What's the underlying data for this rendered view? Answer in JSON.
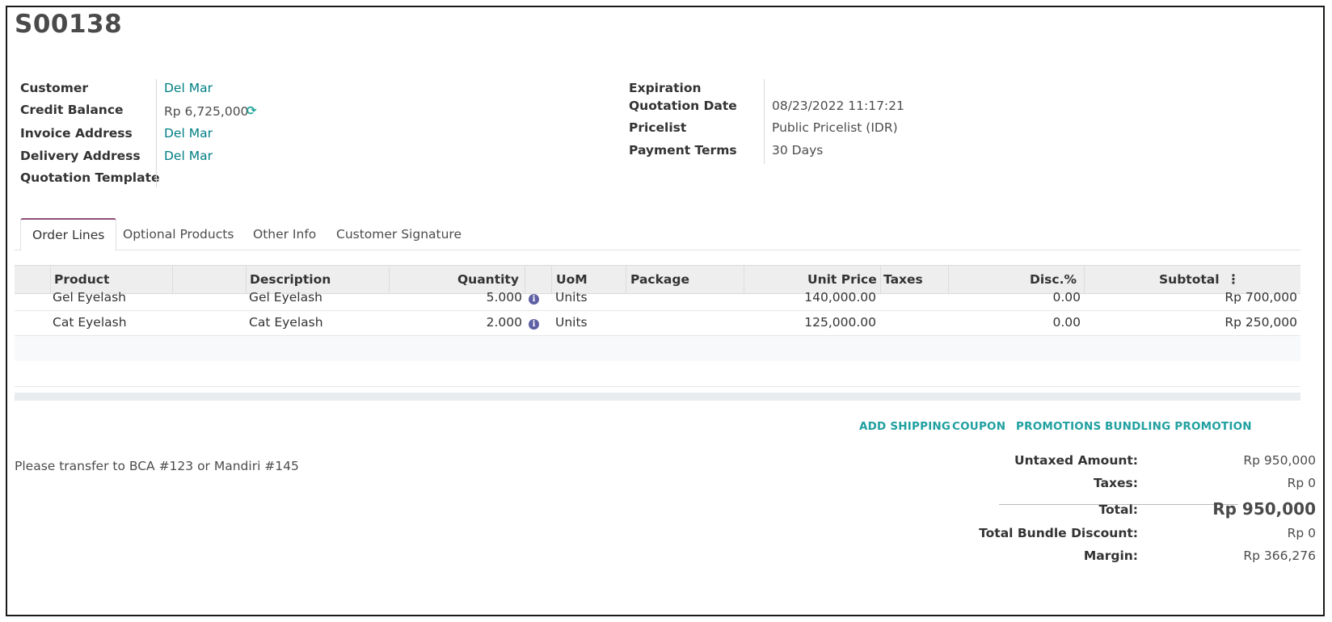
{
  "record": {
    "title": "S00138"
  },
  "left_fields": [
    {
      "label": "Customer",
      "value": "Del Mar",
      "link": true
    },
    {
      "label": "Credit Balance",
      "value": "Rp 6,725,000",
      "link": false,
      "icon": "refresh-icon"
    },
    {
      "label": "Invoice Address",
      "value": "Del Mar",
      "link": true
    },
    {
      "label": "Delivery Address",
      "value": "Del Mar",
      "link": true
    },
    {
      "label": "Quotation Template",
      "value": "",
      "link": false
    }
  ],
  "right_fields": [
    {
      "label": "Expiration",
      "value": ""
    },
    {
      "label": "Quotation Date",
      "value": "08/23/2022 11:17:21"
    },
    {
      "label": "Pricelist",
      "value": "Public Pricelist (IDR)"
    },
    {
      "label": "Payment Terms",
      "value": "30 Days"
    }
  ],
  "tabs": [
    {
      "label": "Order Lines",
      "active": true
    },
    {
      "label": "Optional Products",
      "active": false
    },
    {
      "label": "Other Info",
      "active": false
    },
    {
      "label": "Customer Signature",
      "active": false
    }
  ],
  "table": {
    "columns": [
      "Product",
      "Description",
      "Quantity",
      "UoM",
      "Package",
      "Unit Price",
      "Taxes",
      "Disc.%",
      "Subtotal"
    ],
    "rows": [
      {
        "product": "Gel Eyelash",
        "description": "Gel Eyelash",
        "quantity": "5.000",
        "uom": "Units",
        "package": "",
        "unit_price": "140,000.00",
        "taxes": "",
        "discount": "0.00",
        "subtotal": "Rp 700,000"
      },
      {
        "product": "Cat Eyelash",
        "description": "Cat Eyelash",
        "quantity": "2.000",
        "uom": "Units",
        "package": "",
        "unit_price": "125,000.00",
        "taxes": "",
        "discount": "0.00",
        "subtotal": "Rp 250,000"
      }
    ]
  },
  "actions": [
    "ADD SHIPPING",
    "COUPON",
    "PROMOTIONS",
    "BUNDLING PROMOTION"
  ],
  "note": "Please transfer to BCA #123 or Mandiri #145",
  "totals": {
    "untaxed_label": "Untaxed Amount:",
    "untaxed_value": "Rp 950,000",
    "taxes_label": "Taxes:",
    "taxes_value": "Rp 0",
    "total_label": "Total:",
    "total_value": "Rp 950,000",
    "bundle_label": "Total Bundle Discount:",
    "bundle_value": "Rp 0",
    "margin_label": "Margin:",
    "margin_value": "Rp 366,276"
  },
  "colors": {
    "link": "#017e84",
    "action": "#21a0a0",
    "tab_accent": "#8f4f7a",
    "info_icon": "#5f5fa5"
  }
}
